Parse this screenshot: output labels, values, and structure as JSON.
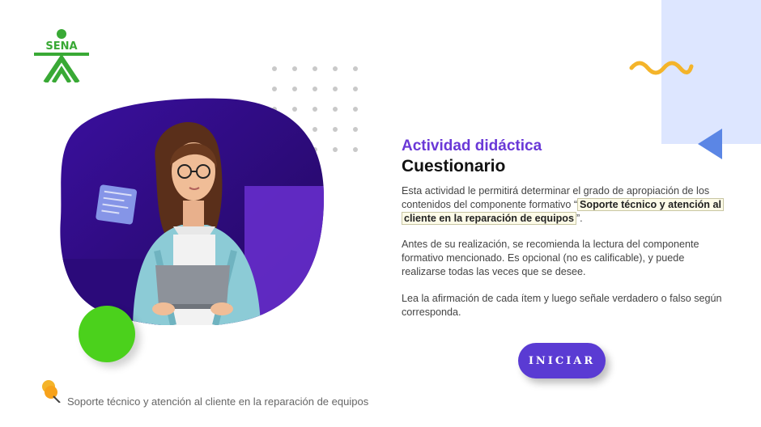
{
  "brand": {
    "logo_text": "SENA"
  },
  "activity": {
    "subtitle": "Actividad didáctica",
    "title": "Cuestionario",
    "para1_before": "Esta actividad le permitirá determinar el grado de apropiación de los contenidos del componente formativo “",
    "para1_highlight": "Soporte técnico y atención al cliente en la reparación de equipos",
    "para1_after": "”.",
    "para2": "Antes de su realización, se recomienda la lectura del componente formativo mencionado.  Es opcional (no es calificable), y puede realizarse todas las veces que se desee.",
    "para3": "Lea la afirmación de cada ítem y luego señale verdadero o falso según corresponda."
  },
  "actions": {
    "start_label": "INICIAR"
  },
  "footer": {
    "course_name": "Soporte técnico y atención al cliente en la reparación de equipos"
  },
  "colors": {
    "accent_purple": "#5a3bd3",
    "subtitle_purple": "#6a38d7",
    "brand_green": "#39a935",
    "decor_green": "#4bd11c",
    "decor_yellow": "#f4b42a",
    "decor_blue": "#5b86e5",
    "panel_blue": "#dde6ff"
  },
  "icons": {
    "logo": "sena-logo",
    "footer": "pushpin-icon",
    "decor_wave": "wave-decoration",
    "decor_triangle": "triangle-decoration"
  }
}
